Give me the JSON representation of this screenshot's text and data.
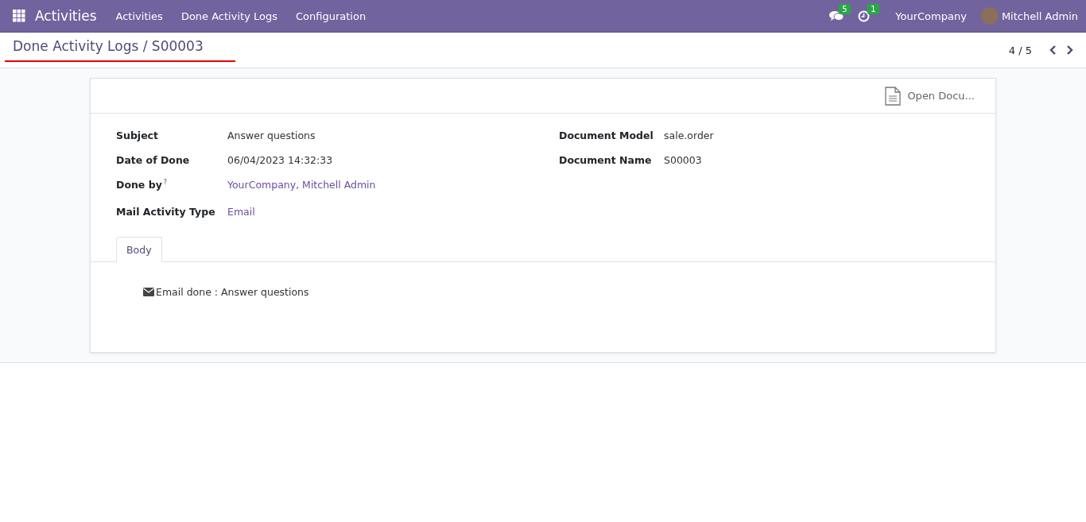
{
  "navbar": {
    "app_name": "Activities",
    "menu": [
      "Activities",
      "Done Activity Logs",
      "Configuration"
    ],
    "messages_count": "5",
    "activities_count": "1",
    "company": "YourCompany",
    "user": "Mitchell Admin"
  },
  "breadcrumb": {
    "title": "Done Activity Logs / S00003",
    "pager": "4 / 5"
  },
  "form": {
    "button": "Open Docu...",
    "left_fields": [
      {
        "label": "Subject",
        "value": "Answer questions",
        "kind": "text"
      },
      {
        "label": "Date of Done",
        "value": "06/04/2023 14:32:33",
        "kind": "text"
      },
      {
        "label": "Done by",
        "help": "?",
        "value": "YourCompany, Mitchell Admin",
        "kind": "link"
      },
      {
        "label": "Mail Activity Type",
        "value": "Email",
        "kind": "link"
      }
    ],
    "right_fields": [
      {
        "label": "Document Model",
        "value": "sale.order"
      },
      {
        "label": "Document Name",
        "value": "S00003"
      }
    ],
    "tabs": [
      {
        "label": "Body",
        "selected": true
      }
    ],
    "body": "Email done : Answer questions"
  }
}
